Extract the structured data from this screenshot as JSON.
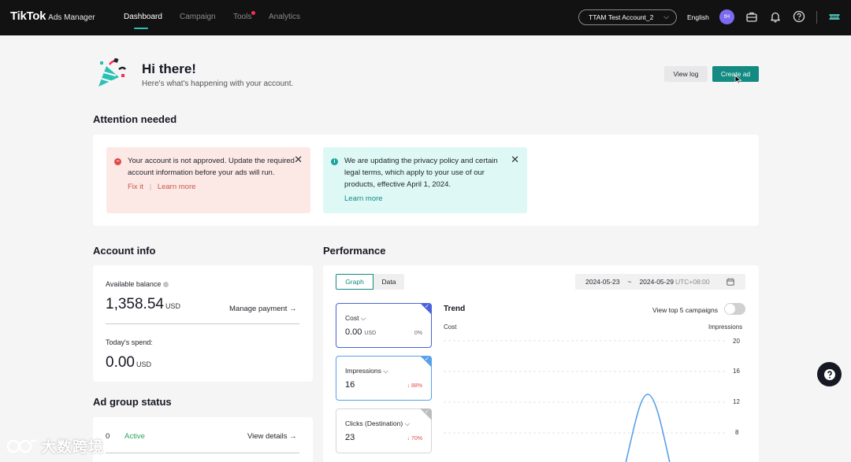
{
  "colors": {
    "accent": "#138a82",
    "topbar": "#121212",
    "selected_metric": "#4a63d8",
    "error": "#e24a4a",
    "success": "#2aa35a"
  },
  "topbar": {
    "brand": "TikTok",
    "brand_sub": "Ads Manager",
    "nav": {
      "dashboard": "Dashboard",
      "campaign": "Campaign",
      "tools": "Tools",
      "analytics": "Analytics"
    },
    "account": "TTAM Test Account_2",
    "language": "English",
    "avatar_initials": "tH",
    "icons": [
      "briefcase-icon",
      "bell-icon",
      "help-icon",
      "ticket-icon"
    ]
  },
  "greeting": {
    "title": "Hi there!",
    "subtitle": "Here's what's happening with your account.",
    "view_log": "View log",
    "create_ad": "Create ad"
  },
  "attention": {
    "title": "Attention needed",
    "error_alert": {
      "text": "Your account is not approved. Update the required account information before your ads will run.",
      "link1": "Fix it",
      "link2": "Learn more"
    },
    "info_alert": {
      "text": "We are updating the privacy policy and certain legal terms, which apply to your use of our products, effective April 1, 2024.",
      "link": "Learn more"
    }
  },
  "account_info": {
    "title": "Account info",
    "balance_label": "Available balance",
    "balance_value": "1,358.54",
    "balance_unit": "USD",
    "manage_payment": "Manage payment →",
    "spend_label": "Today's spend:",
    "spend_value": "0.00",
    "spend_unit": "USD"
  },
  "ad_group": {
    "title": "Ad group status",
    "count": "0",
    "status": "Active",
    "view_details": "View details →"
  },
  "performance": {
    "title": "Performance",
    "tab_graph": "Graph",
    "tab_data": "Data",
    "date_start": "2024-05-23",
    "date_sep": "~",
    "date_end": "2024-05-29",
    "timezone": "UTC+08:00",
    "metrics": [
      {
        "name": "Cost",
        "value": "0.00",
        "unit": "USD",
        "delta": "0%"
      },
      {
        "name": "Impressions",
        "value": "16",
        "unit": "",
        "delta": "↓ 88%"
      },
      {
        "name": "Clicks (Destination)",
        "value": "23",
        "unit": "",
        "delta": "↓ 70%"
      }
    ],
    "trend_title": "Trend",
    "toggle_label": "View top 5 campaigns",
    "left_axis_label": "Cost",
    "right_axis_label": "Impressions",
    "right_ticks": [
      "20",
      "16",
      "12",
      "8"
    ]
  },
  "watermark": "大数跨境"
}
